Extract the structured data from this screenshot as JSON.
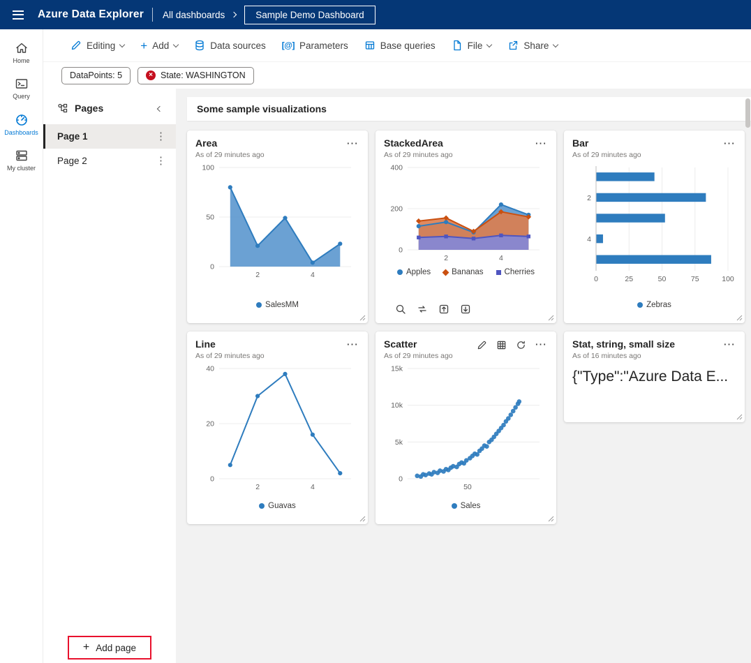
{
  "topbar": {
    "app_title": "Azure Data Explorer",
    "breadcrumb_root": "All dashboards",
    "dashboard_name": "Sample Demo Dashboard"
  },
  "left_rail": {
    "items": [
      {
        "label": "Home"
      },
      {
        "label": "Query"
      },
      {
        "label": "Dashboards"
      },
      {
        "label": "My cluster"
      }
    ]
  },
  "toolbar": {
    "editing": "Editing",
    "add": "Add",
    "data_sources": "Data sources",
    "parameters": "Parameters",
    "base_queries": "Base queries",
    "file": "File",
    "share": "Share"
  },
  "filters": {
    "datapoints_pill": "DataPoints: 5",
    "state_pill": "State: WASHINGTON"
  },
  "pages": {
    "title": "Pages",
    "items": [
      {
        "label": "Page 1"
      },
      {
        "label": "Page 2"
      }
    ],
    "add_page": "Add page"
  },
  "canvas": {
    "section_title": "Some sample visualizations"
  },
  "icons": {
    "plus": "+",
    "kebab": "⋮",
    "more": "⋯",
    "remove": "×",
    "parameters_glyph": "[@]"
  },
  "accent_colors": {
    "header_bg": "#053776",
    "primary_blue": "#0078d4",
    "chart_blue": "#2e7cbe",
    "annotation_red": "#e8112d",
    "error_red": "#c50f1f"
  },
  "chart_data": [
    {
      "type": "area",
      "title": "Area",
      "subtitle": "As of 29 minutes ago",
      "x": [
        1,
        2,
        3,
        4,
        5
      ],
      "xlim": [
        0.6,
        5.4
      ],
      "ylim": [
        0,
        100
      ],
      "ytick_vals": [
        0,
        50,
        100
      ],
      "ytick_labels": [
        "0",
        "50",
        "100"
      ],
      "xtick_vals": [
        2,
        4
      ],
      "xtick_labels": [
        "2",
        "4"
      ],
      "series": [
        {
          "name": "SalesMM",
          "values": [
            80,
            21,
            49,
            4,
            23
          ],
          "color": "#2e7cbe",
          "fill": "#5b97ce",
          "marker": "circle"
        }
      ],
      "legend": [
        {
          "label": "SalesMM",
          "color": "#2e7cbe",
          "marker": "circle"
        }
      ]
    },
    {
      "type": "area",
      "title": "StackedArea",
      "subtitle": "As of 29 minutes ago",
      "x": [
        1,
        2,
        3,
        4,
        5
      ],
      "xlim": [
        0.6,
        5.4
      ],
      "ylim": [
        0,
        400
      ],
      "ytick_vals": [
        0,
        200,
        400
      ],
      "ytick_labels": [
        "0",
        "200",
        "400"
      ],
      "xtick_vals": [
        2,
        4
      ],
      "xtick_labels": [
        "2",
        "4"
      ],
      "series": [
        {
          "name": "Apples",
          "values": [
            115,
            135,
            85,
            220,
            170
          ],
          "color": "#2e7cbe",
          "fill": "#5b97ce",
          "marker": "circle"
        },
        {
          "name": "Bananas",
          "values": [
            140,
            155,
            90,
            185,
            160
          ],
          "color": "#ca5010",
          "fill": "#dd7d4e",
          "marker": "diamond"
        },
        {
          "name": "Cherries",
          "values": [
            60,
            65,
            55,
            70,
            65
          ],
          "color": "#4f55c0",
          "fill": "#8287d9",
          "marker": "square"
        }
      ],
      "legend": [
        {
          "label": "Apples",
          "color": "#2e7cbe",
          "marker": "circle"
        },
        {
          "label": "Bananas",
          "color": "#ca5010",
          "marker": "diamond"
        },
        {
          "label": "Cherries",
          "color": "#4f55c0",
          "marker": "square"
        }
      ]
    },
    {
      "type": "bar-h",
      "title": "Bar",
      "subtitle": "As of 29 minutes ago",
      "categories": [
        "1",
        "2",
        "3",
        "4",
        "5"
      ],
      "values": [
        44,
        83,
        52,
        5,
        87
      ],
      "xlim": [
        0,
        100
      ],
      "xtick_vals": [
        0,
        25,
        50,
        75,
        100
      ],
      "xtick_labels": [
        "0",
        "25",
        "50",
        "75",
        "100"
      ],
      "ytick_rows": [
        1,
        3
      ],
      "ytick_labels": [
        "2",
        "4"
      ],
      "color": "#2e7cbe",
      "legend": [
        {
          "label": "Zebras",
          "color": "#2e7cbe",
          "marker": "circle"
        }
      ]
    },
    {
      "type": "line",
      "title": "Line",
      "subtitle": "As of 29 minutes ago",
      "x": [
        1,
        2,
        3,
        4,
        5
      ],
      "xlim": [
        0.6,
        5.4
      ],
      "ylim": [
        0,
        40
      ],
      "ytick_vals": [
        0,
        20,
        40
      ],
      "ytick_labels": [
        "0",
        "20",
        "40"
      ],
      "xtick_vals": [
        2,
        4
      ],
      "xtick_labels": [
        "2",
        "4"
      ],
      "series": [
        {
          "name": "Guavas",
          "values": [
            5,
            30,
            38,
            16,
            2
          ],
          "color": "#2e7cbe",
          "marker": "circle"
        }
      ],
      "legend": [
        {
          "label": "Guavas",
          "color": "#2e7cbe",
          "marker": "circle"
        }
      ]
    },
    {
      "type": "scatter",
      "title": "Scatter",
      "subtitle": "As of 29 minutes ago",
      "xlim": [
        0,
        110
      ],
      "ylim": [
        0,
        15000
      ],
      "ytick_vals": [
        0,
        5000,
        10000,
        15000
      ],
      "ytick_labels": [
        "0",
        "5k",
        "10k",
        "15k"
      ],
      "xtick_vals": [
        50
      ],
      "xtick_labels": [
        "50"
      ],
      "color": "#2e7cbe",
      "points": [
        [
          8,
          400
        ],
        [
          11,
          300
        ],
        [
          13,
          600
        ],
        [
          15,
          500
        ],
        [
          18,
          700
        ],
        [
          20,
          600
        ],
        [
          22,
          900
        ],
        [
          25,
          800
        ],
        [
          27,
          1100
        ],
        [
          30,
          1000
        ],
        [
          32,
          1300
        ],
        [
          34,
          1200
        ],
        [
          36,
          1500
        ],
        [
          38,
          1700
        ],
        [
          41,
          1600
        ],
        [
          43,
          2000
        ],
        [
          45,
          2200
        ],
        [
          47,
          2100
        ],
        [
          49,
          2500
        ],
        [
          52,
          2800
        ],
        [
          54,
          3100
        ],
        [
          56,
          3400
        ],
        [
          58,
          3300
        ],
        [
          60,
          3800
        ],
        [
          62,
          4100
        ],
        [
          64,
          4500
        ],
        [
          66,
          4400
        ],
        [
          68,
          5000
        ],
        [
          70,
          5300
        ],
        [
          72,
          5700
        ],
        [
          74,
          6100
        ],
        [
          76,
          6500
        ],
        [
          78,
          6900
        ],
        [
          80,
          7300
        ],
        [
          82,
          7800
        ],
        [
          84,
          8200
        ],
        [
          86,
          8700
        ],
        [
          88,
          9200
        ],
        [
          90,
          9700
        ],
        [
          92,
          10200
        ],
        [
          93,
          10500
        ]
      ],
      "legend": [
        {
          "label": "Sales",
          "color": "#2e7cbe",
          "marker": "circle"
        }
      ]
    },
    {
      "type": "stat",
      "title": "Stat, string, small size",
      "subtitle": "As of 16 minutes ago",
      "value": "{\"Type\":\"Azure Data E..."
    }
  ]
}
